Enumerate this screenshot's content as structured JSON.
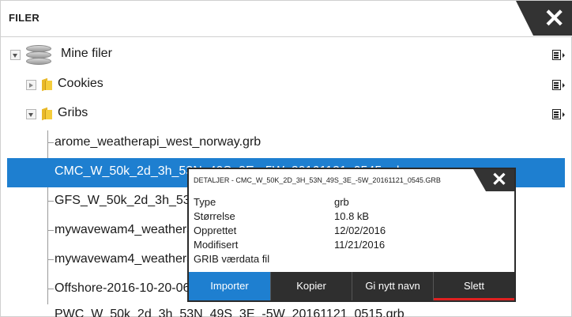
{
  "window": {
    "title": "FILER"
  },
  "tree": {
    "root": {
      "label": "Mine filer",
      "icon": "database-icon"
    },
    "folders": [
      {
        "label": "Cookies",
        "expanded": false,
        "icon": "folder-icon"
      },
      {
        "label": "Gribs",
        "expanded": true,
        "icon": "folder-icon"
      }
    ],
    "files": [
      {
        "label": "arome_weatherapi_west_norway.grb",
        "selected": false
      },
      {
        "label": "CMC_W_50k_2d_3h_53N_49S_3E_-5W_20161121_0545.grb",
        "selected": true
      },
      {
        "label": "GFS_W_50k_2d_3h_53N_4",
        "selected": false
      },
      {
        "label": "mywavewam4_weathera",
        "selected": false
      },
      {
        "label": "mywavewam4_weathera",
        "selected": false
      },
      {
        "label": "Offshore-2016-10-20-06",
        "selected": false
      },
      {
        "label": "PWC_W_50k_2d_3h_53N_49S_3E_-5W_20161121_0515.grb",
        "selected": false
      }
    ]
  },
  "popup": {
    "title": "DETALJER - CMC_W_50K_2D_3H_53N_49S_3E_-5W_20161121_0545.GRB",
    "details": [
      {
        "key": "Type",
        "value": "grb"
      },
      {
        "key": "Størrelse",
        "value": "10.8 kB"
      },
      {
        "key": "Opprettet",
        "value": "12/02/2016"
      },
      {
        "key": "Modifisert",
        "value": "11/21/2016"
      },
      {
        "key": "GRIB værdata fil",
        "value": ""
      }
    ],
    "buttons": {
      "import": "Importer",
      "copy": "Kopier",
      "rename": "Gi nytt navn",
      "delete": "Slett"
    }
  },
  "colors": {
    "selection": "#1e7fd0",
    "dark": "#2f2f2f",
    "danger": "#e02020"
  }
}
